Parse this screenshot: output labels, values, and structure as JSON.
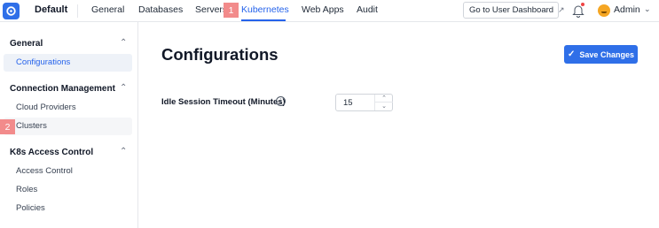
{
  "topbar": {
    "workspace": "Default",
    "tabs": [
      {
        "label": "General"
      },
      {
        "label": "Databases"
      },
      {
        "label": "Servers"
      },
      {
        "label": "Kubernetes",
        "active": true
      },
      {
        "label": "Web Apps"
      },
      {
        "label": "Audit"
      }
    ],
    "dashboard_button": "Go to User Dashboard",
    "user_name": "Admin"
  },
  "badges": [
    "1",
    "2"
  ],
  "sidebar": {
    "sections": [
      {
        "title": "General",
        "items": [
          {
            "label": "Configurations",
            "active": true
          }
        ]
      },
      {
        "title": "Connection Management",
        "items": [
          {
            "label": "Cloud Providers"
          },
          {
            "label": "Clusters"
          }
        ]
      },
      {
        "title": "K8s Access Control",
        "items": [
          {
            "label": "Access Control"
          },
          {
            "label": "Roles"
          },
          {
            "label": "Policies"
          }
        ]
      }
    ]
  },
  "main": {
    "title": "Configurations",
    "save_label": "Save Changes",
    "field_label": "Idle Session Timeout (Minutes)",
    "field_value": "15"
  },
  "colors": {
    "accent": "#2f6fe8",
    "active_text": "#2563eb",
    "badge": "#f28b8b"
  }
}
